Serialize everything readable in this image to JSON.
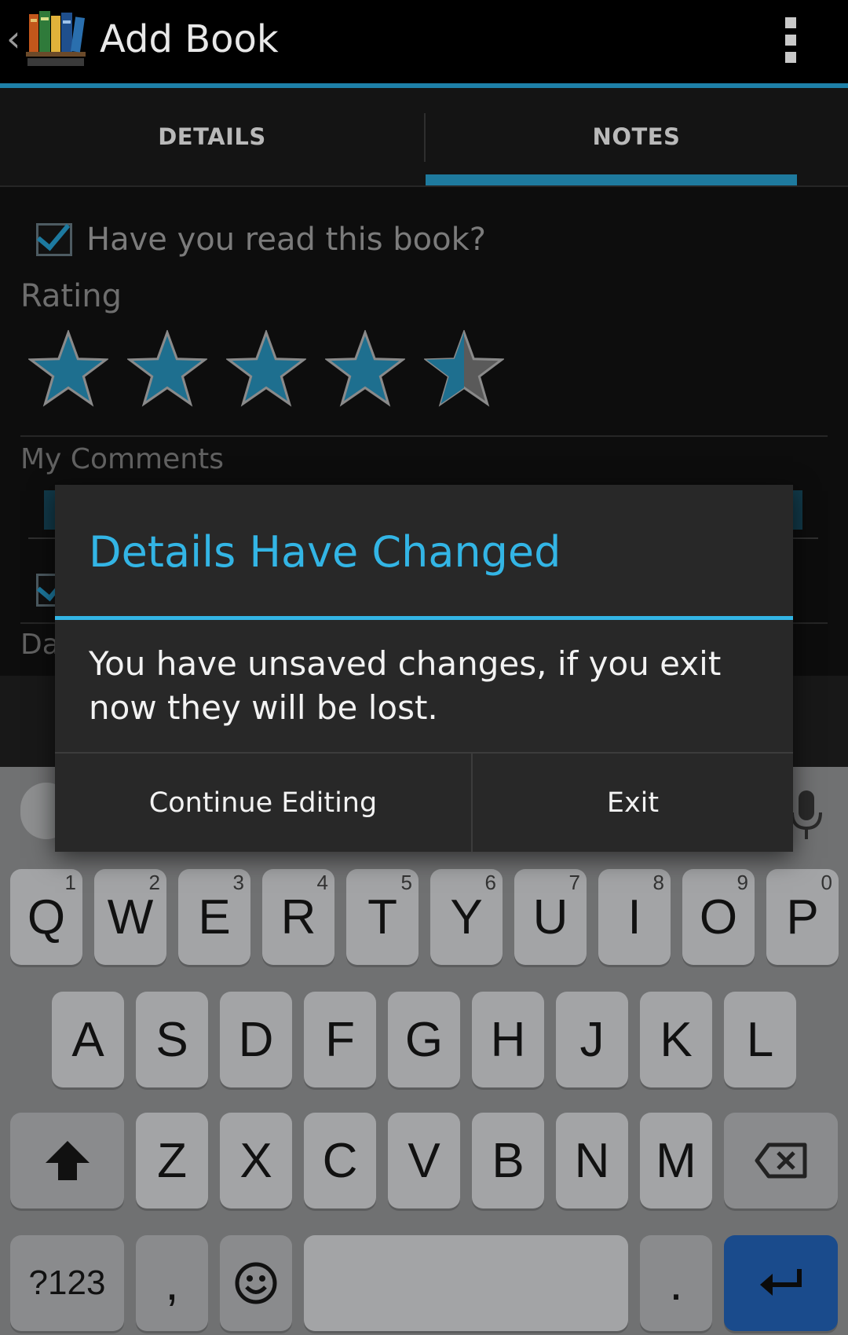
{
  "app_bar": {
    "title": "Add Book",
    "back_icon": "‹"
  },
  "tabs": [
    {
      "label": "DETAILS",
      "selected": false
    },
    {
      "label": "NOTES",
      "selected": true
    }
  ],
  "notes": {
    "read_label": "Have you read this book?",
    "read_checked": true,
    "rating_label": "Rating",
    "rating_value": 4.5,
    "rating_max": 5,
    "comments_label": "My Comments",
    "date_label_partial": "Da"
  },
  "dialog": {
    "title": "Details Have Changed",
    "message": "You have unsaved changes, if you exit now they will be lost.",
    "buttons": {
      "continue": "Continue Editing",
      "exit": "Exit"
    }
  },
  "keyboard": {
    "row1": [
      "Q",
      "W",
      "E",
      "R",
      "T",
      "Y",
      "U",
      "I",
      "O",
      "P"
    ],
    "row1_nums": [
      "1",
      "2",
      "3",
      "4",
      "5",
      "6",
      "7",
      "8",
      "9",
      "0"
    ],
    "row2": [
      "A",
      "S",
      "D",
      "F",
      "G",
      "H",
      "J",
      "K",
      "L"
    ],
    "row3": [
      "Z",
      "X",
      "C",
      "V",
      "B",
      "N",
      "M"
    ],
    "symbols_key": "?123",
    "comma_key": ",",
    "period_key": "."
  },
  "colors": {
    "accent": "#33b5e5",
    "star_fill": "#1e6f8f"
  }
}
